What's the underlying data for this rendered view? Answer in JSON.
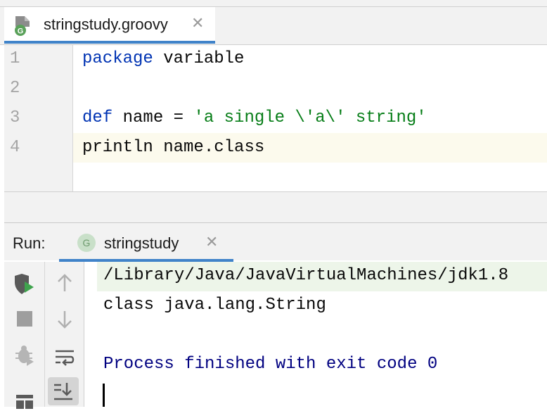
{
  "editor": {
    "tab_filename": "stringstudy.groovy",
    "tab_close": "✕",
    "lines": [
      {
        "number": "1",
        "tokens": [
          {
            "t": "package",
            "k": "kw"
          },
          {
            "t": " variable",
            "k": ""
          }
        ]
      },
      {
        "number": "2",
        "tokens": []
      },
      {
        "number": "3",
        "tokens": [
          {
            "t": "def",
            "k": "kw"
          },
          {
            "t": " name = ",
            "k": ""
          },
          {
            "t": "'a single \\'a\\' string'",
            "k": "str"
          }
        ]
      },
      {
        "number": "4",
        "tokens": [
          {
            "t": "println name.class",
            "k": ""
          }
        ]
      }
    ],
    "current_line": "4"
  },
  "run": {
    "label": "Run:",
    "tab_icon_letter": "G",
    "tab_label": "stringstudy",
    "tab_close": "✕",
    "toolbar_left": [
      "rerun-icon",
      "stop-icon",
      "debug-icon",
      "layout-icon"
    ],
    "toolbar_right": [
      "up-arrow-icon",
      "down-arrow-icon",
      "soft-wrap-icon",
      "scroll-to-end-icon"
    ]
  },
  "console": {
    "command": "/Library/Java/JavaVirtualMachines/jdk1.8",
    "output": "class java.lang.String",
    "exit_message": "Process finished with exit code 0"
  },
  "colors": {
    "keyword": "#0033b3",
    "string": "#067d17",
    "exit_message": "#000080",
    "accent": "#4083c9"
  }
}
